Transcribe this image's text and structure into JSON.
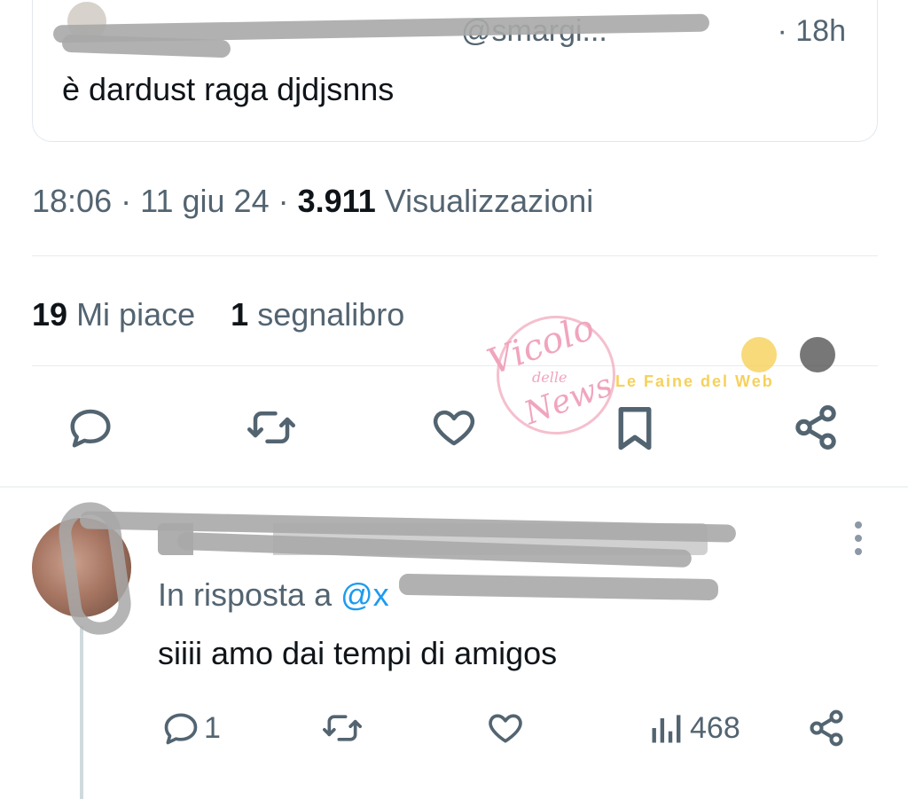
{
  "quoted_tweet": {
    "handle": "@smargi...",
    "time": "· 18h",
    "text": "è dardust raga djdjsnns"
  },
  "tweet_meta": {
    "time": "18:06",
    "sep1": "·",
    "date": "11 giu 24",
    "sep2": "·",
    "views_count": "3.911",
    "views_label": "Visualizzazioni"
  },
  "stats": {
    "likes_count": "19",
    "likes_label": "Mi piace",
    "bookmarks_count": "1",
    "bookmarks_label": "segnalibro"
  },
  "action_icons": [
    "reply-icon",
    "retweet-icon",
    "like-icon",
    "bookmark-icon",
    "share-icon"
  ],
  "reply": {
    "in_reply_prefix": "In risposta a",
    "mention": "@x",
    "text": "siiii amo dai tempi di amigos",
    "reply_count": "1",
    "views_count": "468"
  },
  "watermark": {
    "text1": "Vicolo",
    "text2": "delle",
    "text3": "News",
    "text4": "Le Faine del Web"
  },
  "colors": {
    "accent": "#1d9bf0",
    "secondary_text": "#536471",
    "primary_text": "#0f1419",
    "divider": "#e6ecf0"
  }
}
